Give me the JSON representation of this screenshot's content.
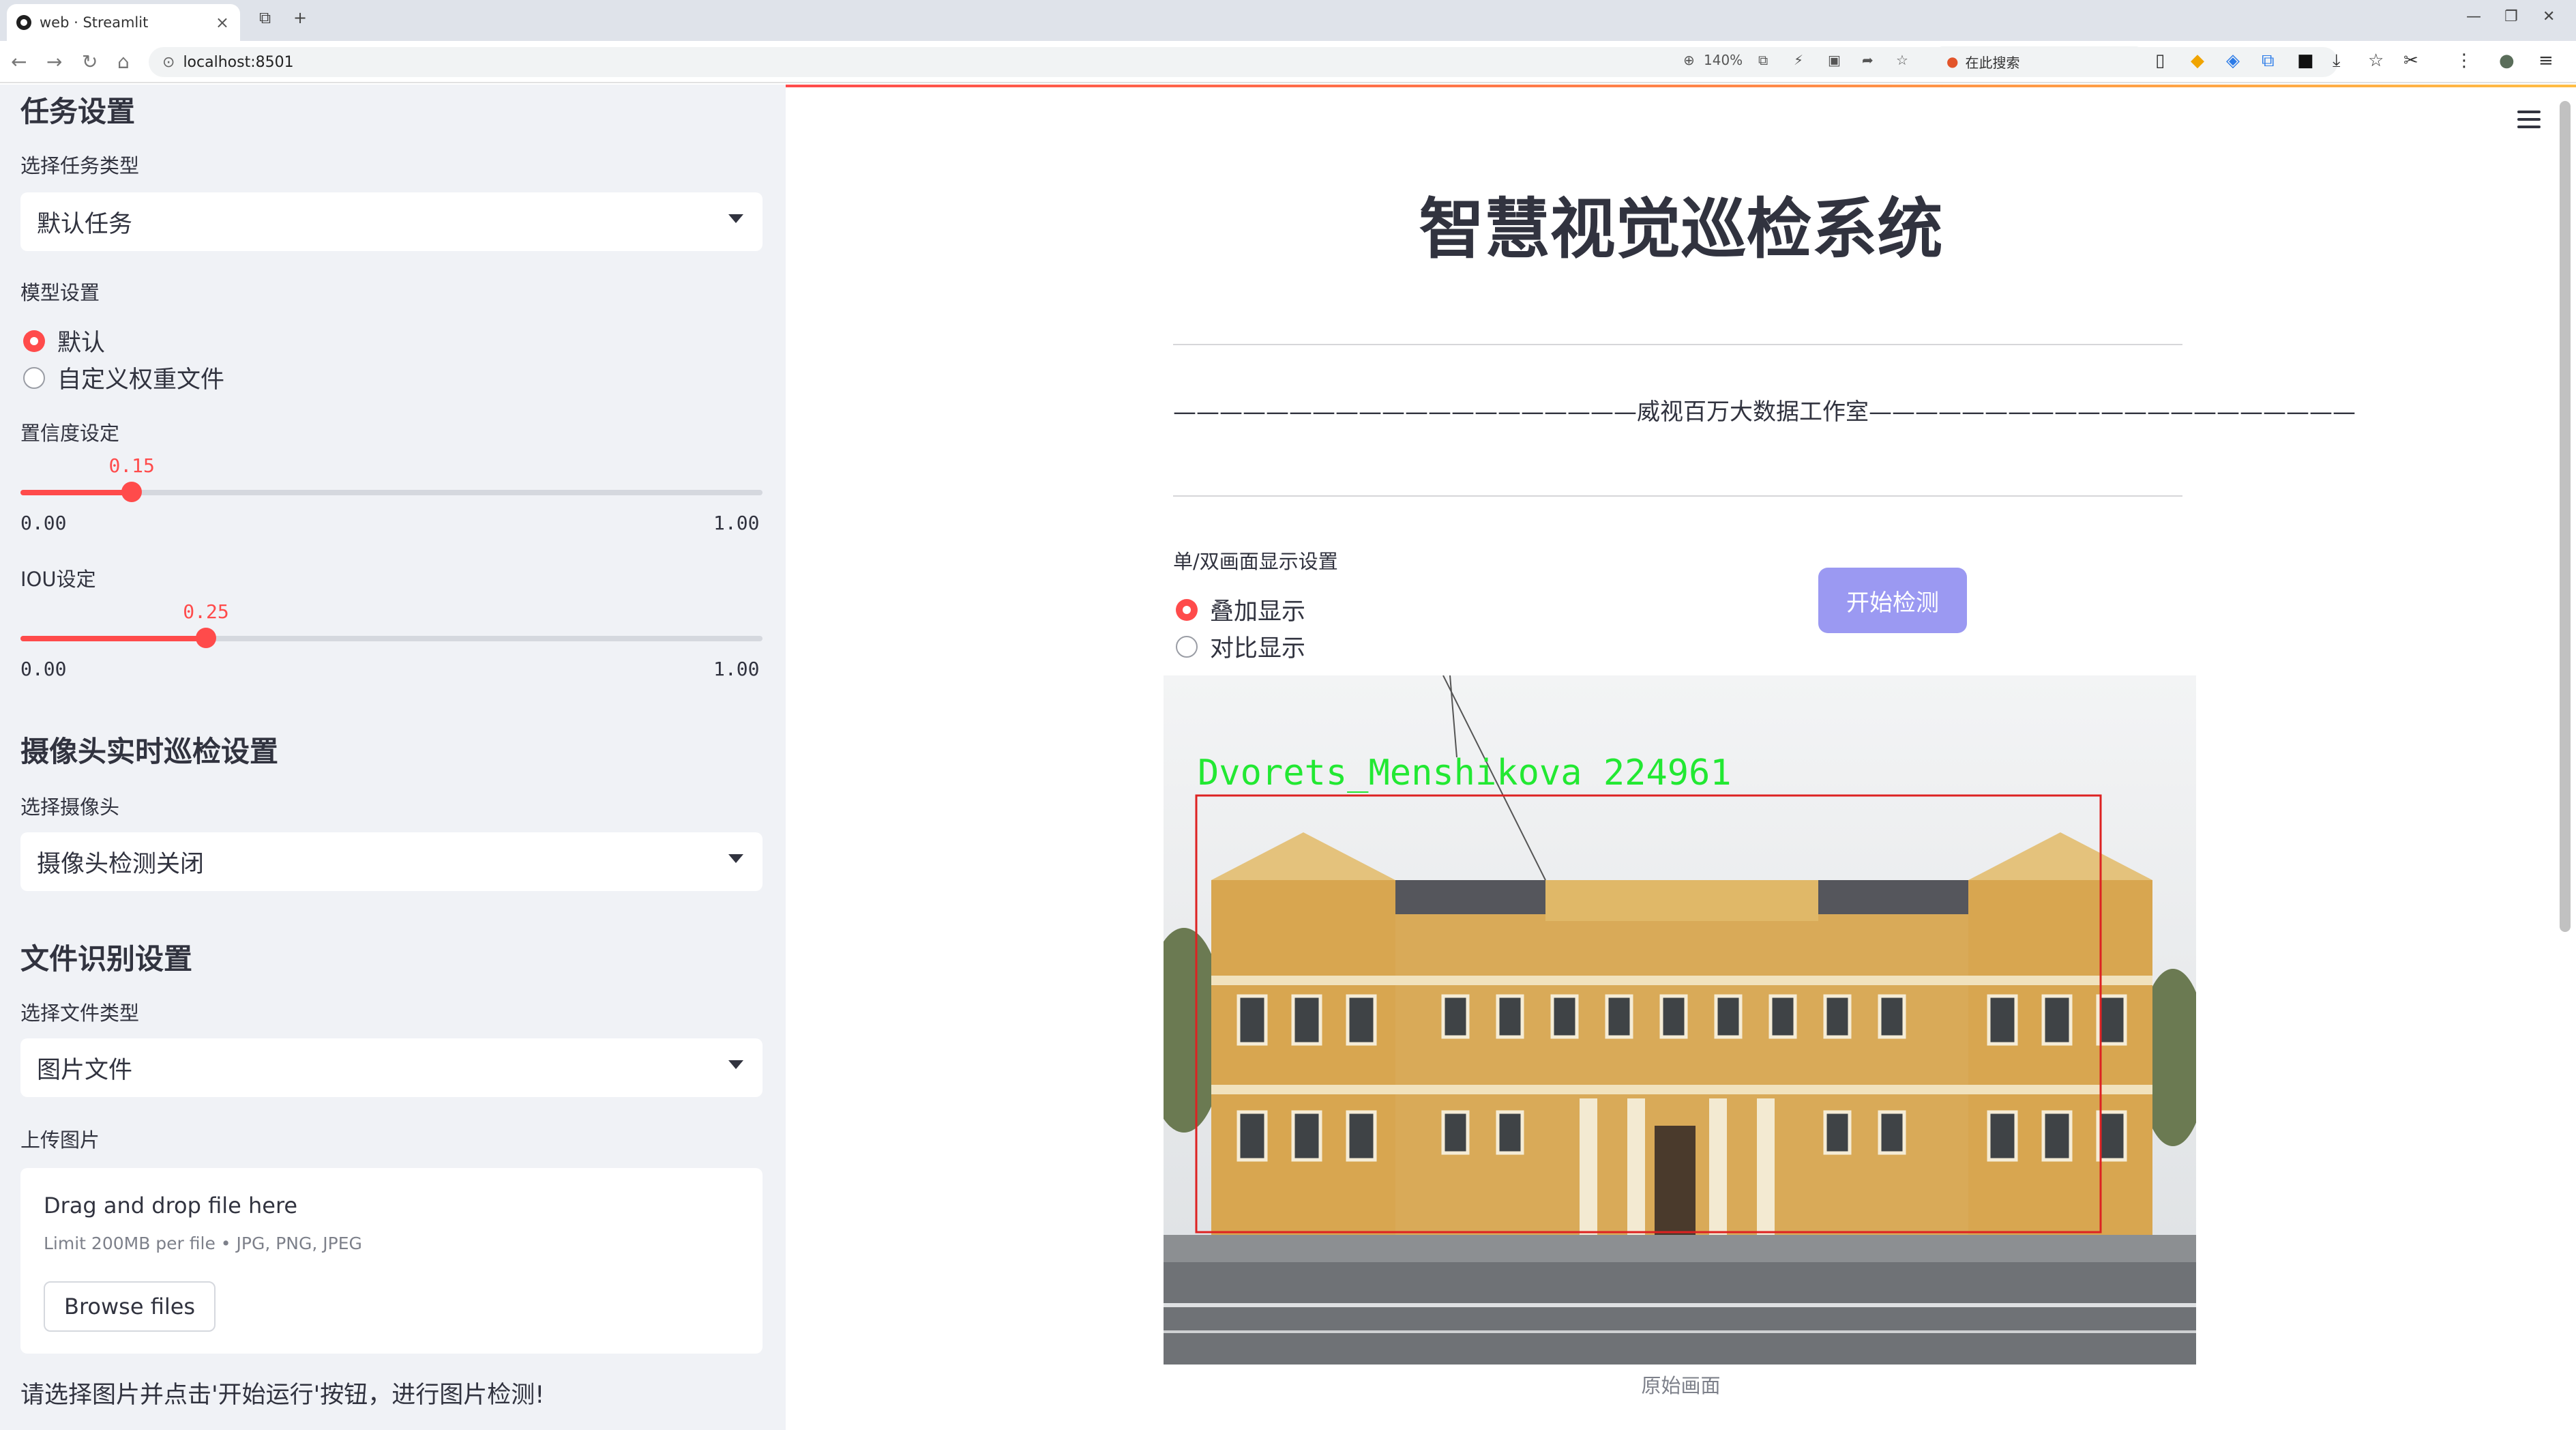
{
  "browser": {
    "tab_title": "web · Streamlit",
    "url": "localhost:8501",
    "zoom": "140%",
    "search_placeholder": "在此搜索"
  },
  "sidebar": {
    "task_section": "任务设置",
    "task_type_label": "选择任务类型",
    "task_type_value": "默认任务",
    "model_label": "模型设置",
    "model_options": [
      "默认",
      "自定义权重文件"
    ],
    "model_selected": 0,
    "conf_label": "置信度设定",
    "conf_value": "0.15",
    "conf_fraction": 0.15,
    "conf_min": "0.00",
    "conf_max": "1.00",
    "iou_label": "IOU设定",
    "iou_value": "0.25",
    "iou_fraction": 0.25,
    "iou_min": "0.00",
    "iou_max": "1.00",
    "camera_section": "摄像头实时巡检设置",
    "camera_label": "选择摄像头",
    "camera_value": "摄像头检测关闭",
    "file_section": "文件识别设置",
    "file_type_label": "选择文件类型",
    "file_type_value": "图片文件",
    "upload_label": "上传图片",
    "upload_drag": "Drag and drop file here",
    "upload_limit": "Limit 200MB per file • JPG, PNG, JPEG",
    "browse_label": "Browse files",
    "hint": "请选择图片并点击'开始运行'按钮，进行图片检测!"
  },
  "main": {
    "title": "智慧视觉巡检系统",
    "subtitle": "————————————————————威视百万大数据工作室—————————————————————",
    "display_label": "单/双画面显示设置",
    "display_options": [
      "叠加显示",
      "对比显示"
    ],
    "display_selected": 0,
    "start_button": "开始检测",
    "detection_label": "Dvorets_Menshikova  224961",
    "caption": "原始画面"
  }
}
